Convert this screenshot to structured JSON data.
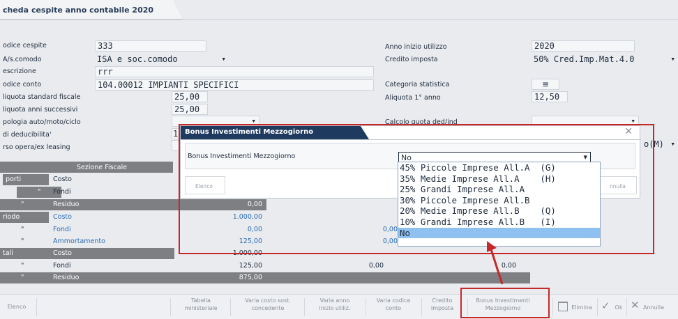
{
  "tab_title": "cheda cespite anno contabile 2020",
  "form": {
    "codice_cespite_label": "odice cespite",
    "codice_cespite_value": "333",
    "comodo_label": "A/s.comodo",
    "comodo_value": "ISA e soc.comodo",
    "descrizione_label": "escrizione",
    "descrizione_value": "rrr",
    "codice_conto_label": "odice conto",
    "codice_conto_value": "104.00012 IMPIANTI SPECIFICI",
    "aliquota_std_label": "liquota standard fiscale",
    "aliquota_std_value": "25,00",
    "aliquota_succ_label": "liquota anni successivi",
    "aliquota_succ_value": "25,00",
    "tipologia_label": "pologia auto/moto/ciclo",
    "deducibilita_label": "di deducibilita'",
    "deducibilita_value": "1",
    "opera_label": "rso opera/ex leasing",
    "anno_inizio_label": "Anno inizio utilizzo",
    "anno_inizio_value": "2020",
    "credito_label": "Credito imposta",
    "credito_value": "50% Cred.Imp.Mat.4.0",
    "categoria_label": "Categoria statistica",
    "categoria_value": "≡",
    "aliquota_1_label": "Aliquota 1° anno",
    "aliquota_1_value": "12,50",
    "calcolo_label": "Calcolo quota ded/ind",
    "right_partial_value": "o(M)"
  },
  "table": {
    "header": "Sezione Fiscale",
    "rows": [
      {
        "a": "porti",
        "b": "Costo",
        "v": "",
        "v2": "",
        "v3": ""
      },
      {
        "a": "\"",
        "b": "Fondi",
        "v": "",
        "v2": "",
        "v3": ""
      },
      {
        "a": "\"",
        "b": "Residuo",
        "v": "0,00",
        "v2": "",
        "v3": ""
      },
      {
        "a": "riodo",
        "b": "Costo",
        "v": "1.000,00",
        "v2": "",
        "v3": ""
      },
      {
        "a": "\"",
        "b": "Fondi",
        "v": "0,00",
        "v2": "0,00",
        "v3": ""
      },
      {
        "a": "\"",
        "b": "Ammortamento",
        "v": "125,00",
        "v2": "0,00",
        "v3": ""
      },
      {
        "a": "tali",
        "b": "Costo",
        "v": "1.000,00",
        "v2": "",
        "v3": ""
      },
      {
        "a": "\"",
        "b": "Fondi",
        "v": "125,00",
        "v2": "0,00",
        "v3": "0,00"
      },
      {
        "a": "\"",
        "b": "Residuo",
        "v": "875,00",
        "v2": "",
        "v3": ""
      }
    ]
  },
  "dialog": {
    "title": "Bonus Investimenti Mezzogiorno",
    "field_label": "Bonus Investimenti Mezzogiorno",
    "field_value": "No",
    "elenco": "Elenco",
    "annulla": "nnulla",
    "close": "✕",
    "options": [
      "45% Piccole Imprese All.A  (G)",
      "35% Medie Imprese All.A    (H)",
      "25% Grandi Imprese All.A",
      "30% Piccole Imprese All.B",
      "20% Medie Imprese All.B    (Q)",
      "10% Grandi Imprese All.B   (I)",
      "No"
    ]
  },
  "toolbar": {
    "elenco": "Elenco",
    "tabella_1": "Tabella",
    "tabella_2": "ministeriale",
    "varia_costo_1": "Varia costo sost.",
    "varia_costo_2": "concedente",
    "varia_anno_1": "Varia anno",
    "varia_anno_2": "inizio utiliz.",
    "varia_codice_1": "Varia codice",
    "varia_codice_2": "conto",
    "credito_1": "Credito",
    "credito_2": "Imposta",
    "bonus_1": "Bonus Investimenti",
    "bonus_2": "Mezzogiorno",
    "elimina": "Elimina",
    "ok": "Ok",
    "annulla": "Annulla"
  },
  "colors": {
    "accent_dark": "#1f3a5f",
    "highlight": "#c62828",
    "selected": "#8ec1f0"
  }
}
